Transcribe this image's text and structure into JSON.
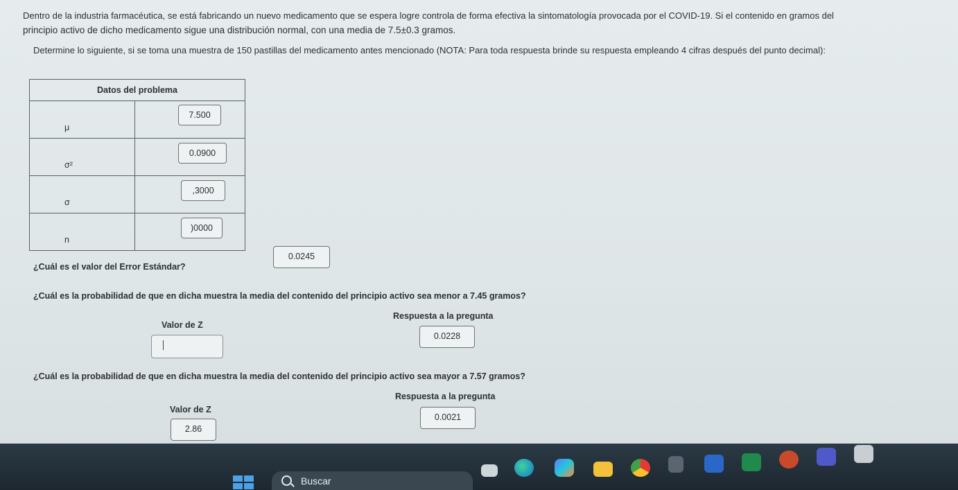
{
  "intro": {
    "line1": "Dentro de la industria farmacéutica, se está fabricando un nuevo medicamento que se espera logre controla de forma efectiva la sintomatología provocada por el COVID-19. Si el contenido en gramos del",
    "line2": "principio activo de dicho medicamento sigue una distribución normal, con una media de 7.5±0.3 gramos.",
    "line3": "Determine lo siguiente, si se toma una muestra de 150 pastillas del medicamento antes mencionado (NOTA: Para toda respuesta brinde su respuesta empleando 4 cifras después del punto decimal):"
  },
  "table": {
    "title": "Datos del problema",
    "rows": [
      {
        "label": "μ",
        "value": "7.500"
      },
      {
        "label": "σ²",
        "value": "0.0900"
      },
      {
        "label": "σ",
        "value": ",3000"
      },
      {
        "label": "n",
        "value": ")0000"
      }
    ]
  },
  "q1": {
    "text": "¿Cuál es el valor del Error Estándar?",
    "answer": "0.0245"
  },
  "q2": {
    "text": "¿Cuál es la probabilidad de que en dicha muestra la media del contenido del principio activo  sea menor a 7.45 gramos?",
    "z_label": "Valor de Z",
    "z_value": "",
    "answer_label": "Respuesta a la pregunta",
    "answer": "0.0228"
  },
  "q3": {
    "text": "¿Cuál es la probabilidad de que en dicha muestra la media del contenido del principio activo sea mayor a 7.57 gramos?",
    "z_label": "Valor de Z",
    "z_value": "2.86",
    "answer_label": "Respuesta a la pregunta",
    "answer": "0.0021"
  },
  "taskbar": {
    "search_label": "Buscar",
    "icons": [
      "windows-start-icon",
      "search-icon",
      "file-explorer-icon",
      "edge-icon",
      "copilot-icon",
      "folder-icon",
      "chrome-icon",
      "calculator-icon",
      "word-icon",
      "excel-icon",
      "powerpoint-icon",
      "teams-icon",
      "calendar-icon"
    ]
  }
}
